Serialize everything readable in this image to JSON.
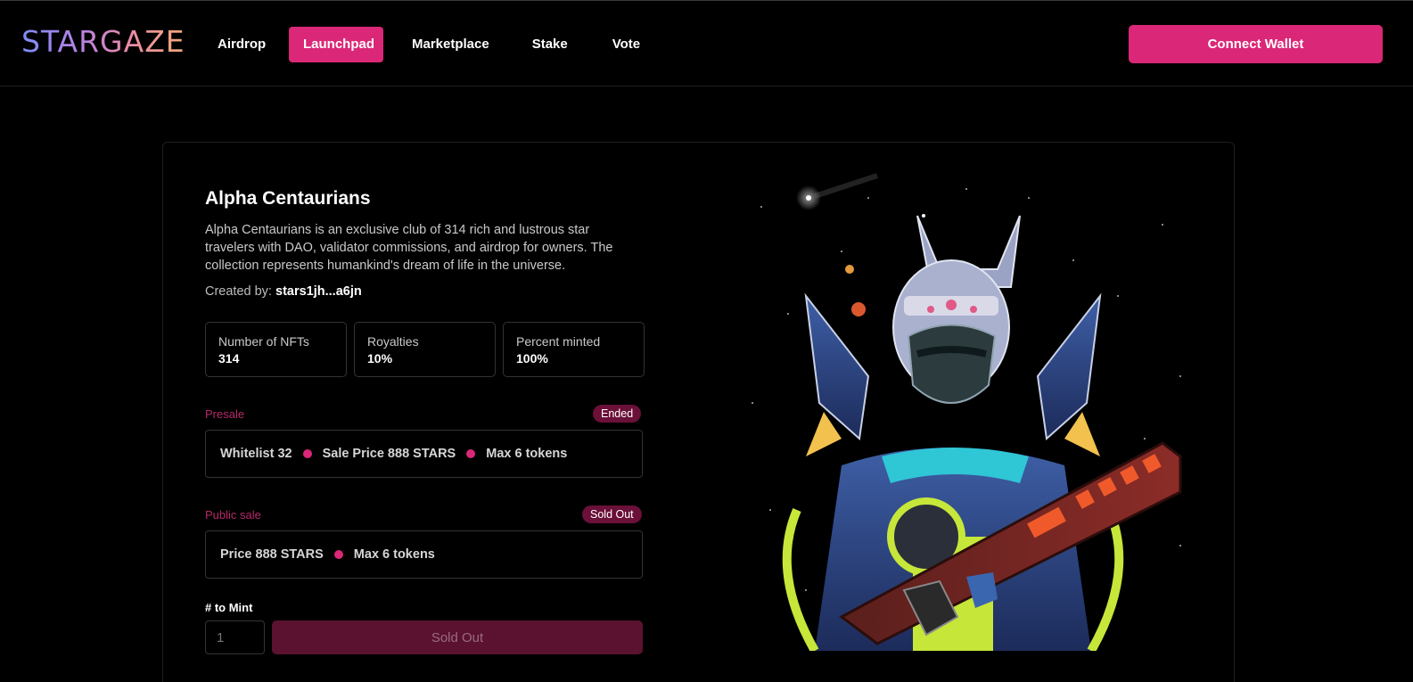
{
  "header": {
    "logo": "STARGAZE",
    "nav": [
      "Airdrop",
      "Launchpad",
      "Marketplace",
      "Stake",
      "Vote"
    ],
    "active_nav": "Launchpad",
    "connect_label": "Connect Wallet"
  },
  "collection": {
    "title": "Alpha Centaurians",
    "description": "Alpha Centaurians is an exclusive club of 314 rich and lustrous star travelers with DAO, validator commissions, and airdrop for owners. The collection represents humankind's dream of life in the universe.",
    "creator_label": "Created by: ",
    "creator_address": "stars1jh...a6jn",
    "stats": [
      {
        "label": "Number of NFTs",
        "value": "314"
      },
      {
        "label": "Royalties",
        "value": "10%"
      },
      {
        "label": "Percent minted",
        "value": "100%"
      }
    ]
  },
  "presale": {
    "label": "Presale",
    "status": "Ended",
    "items": [
      "Whitelist 32",
      "Sale Price 888 STARS",
      "Max 6 tokens"
    ]
  },
  "public_sale": {
    "label": "Public sale",
    "status": "Sold Out",
    "items": [
      "Price 888 STARS",
      "Max 6 tokens"
    ]
  },
  "mint": {
    "label": "# to Mint",
    "placeholder": "1",
    "button_label": "Sold Out"
  },
  "colors": {
    "accent": "#db2777",
    "badge": "#6b1038",
    "disabled_button": "#5a1230"
  }
}
